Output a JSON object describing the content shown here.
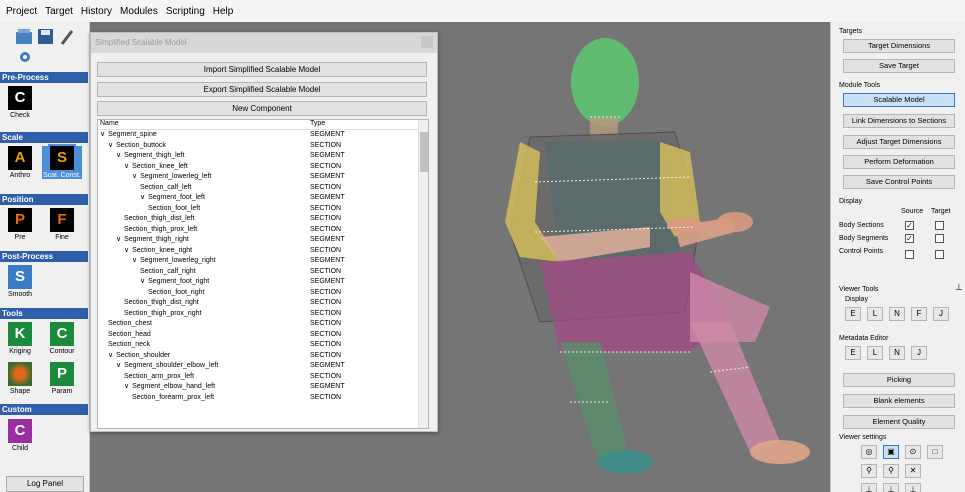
{
  "menu": [
    "Project",
    "Target",
    "History",
    "Modules",
    "Scripting",
    "Help"
  ],
  "left_panel": {
    "sections": {
      "preprocess": "Pre-Process",
      "scale": "Scale",
      "position": "Position",
      "postprocess": "Post-Process",
      "tools": "Tools",
      "custom": "Custom"
    },
    "tools": {
      "check": {
        "letter": "C",
        "label": "Check"
      },
      "anthro": {
        "letter": "A",
        "label": "Anthro"
      },
      "scal_const": {
        "letter": "S",
        "label": "Scal. Const."
      },
      "pre": {
        "letter": "P",
        "label": "Pre"
      },
      "fine": {
        "letter": "F",
        "label": "Fine"
      },
      "smooth": {
        "letter": "S",
        "label": "Smooth"
      },
      "kriging": {
        "letter": "K",
        "label": "Kriging"
      },
      "contour": {
        "letter": "C",
        "label": "Contour"
      },
      "shape": {
        "label": "Shape"
      },
      "param": {
        "letter": "P",
        "label": "Param"
      },
      "child": {
        "letter": "C",
        "label": "Child"
      }
    },
    "log_panel": "Log Panel"
  },
  "dialog": {
    "title": "Simplified Scalable Model",
    "import_btn": "Import Simplified Scalable Model",
    "export_btn": "Export Simplified Scalable Model",
    "new_component_btn": "New Component",
    "tree_header": {
      "name": "Name",
      "type": "Type"
    },
    "tree_rows": [
      {
        "name": "Segment_spine",
        "type": "SEGMENT",
        "level": 0,
        "arrow": "∨"
      },
      {
        "name": "Section_buttock",
        "type": "SECTION",
        "level": 1,
        "arrow": "∨"
      },
      {
        "name": "Segment_thigh_left",
        "type": "SEGMENT",
        "level": 2,
        "arrow": "∨"
      },
      {
        "name": "Section_knee_left",
        "type": "SECTION",
        "level": 3,
        "arrow": "∨"
      },
      {
        "name": "Segment_lowerleg_left",
        "type": "SEGMENT",
        "level": 4,
        "arrow": "∨"
      },
      {
        "name": "Section_calf_left",
        "type": "SECTION",
        "level": 5,
        "arrow": ""
      },
      {
        "name": "Segment_foot_left",
        "type": "SEGMENT",
        "level": 5,
        "arrow": "∨"
      },
      {
        "name": "Section_foot_left",
        "type": "SECTION",
        "level": 6,
        "arrow": ""
      },
      {
        "name": "Section_thigh_dist_left",
        "type": "SECTION",
        "level": 3,
        "arrow": ""
      },
      {
        "name": "Section_thigh_prox_left",
        "type": "SECTION",
        "level": 3,
        "arrow": ""
      },
      {
        "name": "Segment_thigh_right",
        "type": "SEGMENT",
        "level": 2,
        "arrow": "∨"
      },
      {
        "name": "Section_knee_right",
        "type": "SECTION",
        "level": 3,
        "arrow": "∨"
      },
      {
        "name": "Segment_lowerleg_right",
        "type": "SEGMENT",
        "level": 4,
        "arrow": "∨"
      },
      {
        "name": "Section_calf_right",
        "type": "SECTION",
        "level": 5,
        "arrow": ""
      },
      {
        "name": "Segment_foot_right",
        "type": "SEGMENT",
        "level": 5,
        "arrow": "∨"
      },
      {
        "name": "Section_foot_right",
        "type": "SECTION",
        "level": 6,
        "arrow": ""
      },
      {
        "name": "Section_thigh_dist_right",
        "type": "SECTION",
        "level": 3,
        "arrow": ""
      },
      {
        "name": "Section_thigh_prox_right",
        "type": "SECTION",
        "level": 3,
        "arrow": ""
      },
      {
        "name": "Section_chest",
        "type": "SECTION",
        "level": 1,
        "arrow": ""
      },
      {
        "name": "Section_head",
        "type": "SECTION",
        "level": 1,
        "arrow": ""
      },
      {
        "name": "Section_neck",
        "type": "SECTION",
        "level": 1,
        "arrow": ""
      },
      {
        "name": "Section_shoulder",
        "type": "SECTION",
        "level": 1,
        "arrow": "∨"
      },
      {
        "name": "Segment_shoulder_elbow_left",
        "type": "SEGMENT",
        "level": 2,
        "arrow": "∨"
      },
      {
        "name": "Section_arm_prox_left",
        "type": "SECTION",
        "level": 3,
        "arrow": ""
      },
      {
        "name": "Segment_elbow_hand_left",
        "type": "SEGMENT",
        "level": 3,
        "arrow": "∨"
      },
      {
        "name": "Section_forearm_prox_left",
        "type": "SECTION",
        "level": 4,
        "arrow": ""
      }
    ]
  },
  "right_panel": {
    "targets_label": "Targets",
    "target_dimensions": "Target Dimensions",
    "save_target": "Save Target",
    "module_tools_label": "Module Tools",
    "scalable_model": "Scalable Model",
    "link_dimensions": "Link Dimensions to Sections",
    "adjust_target": "Adjust Target Dimensions",
    "perform_deformation": "Perform Deformation",
    "save_control_points": "Save Control Points",
    "display_label": "Display",
    "source": "Source",
    "target": "Target",
    "body_sections": "Body Sections",
    "body_segments": "Body Segments",
    "control_points": "Control Points",
    "viewer_tools_label": "Viewer Tools",
    "display_sub": "Display",
    "metadata_editor": "Metadata Editor",
    "picking": "Picking",
    "blank_elements": "Blank elements",
    "element_quality": "Element Quality",
    "viewer_settings": "Viewer settings",
    "display_icons": [
      "E",
      "L",
      "N",
      "F",
      "J"
    ],
    "metadata_icons": [
      "E",
      "L",
      "N",
      "J"
    ],
    "check_mark": "✓",
    "pin": "⊥"
  },
  "colors": {
    "viewport_bg": "#757575",
    "section_header": "#2f5faa",
    "active_blue": "#4a90d9",
    "tile_A": "#e8a000",
    "tile_S": "#e8a000",
    "tile_P": "#e86a00",
    "tile_F": "#e86a00",
    "tile_Smooth": "#3b7cc9",
    "tile_K": "#1b8a3c",
    "tile_C_contour": "#1b8a3c",
    "tile_Param": "#1b8a3c",
    "tile_Child": "#9b2ea0"
  }
}
